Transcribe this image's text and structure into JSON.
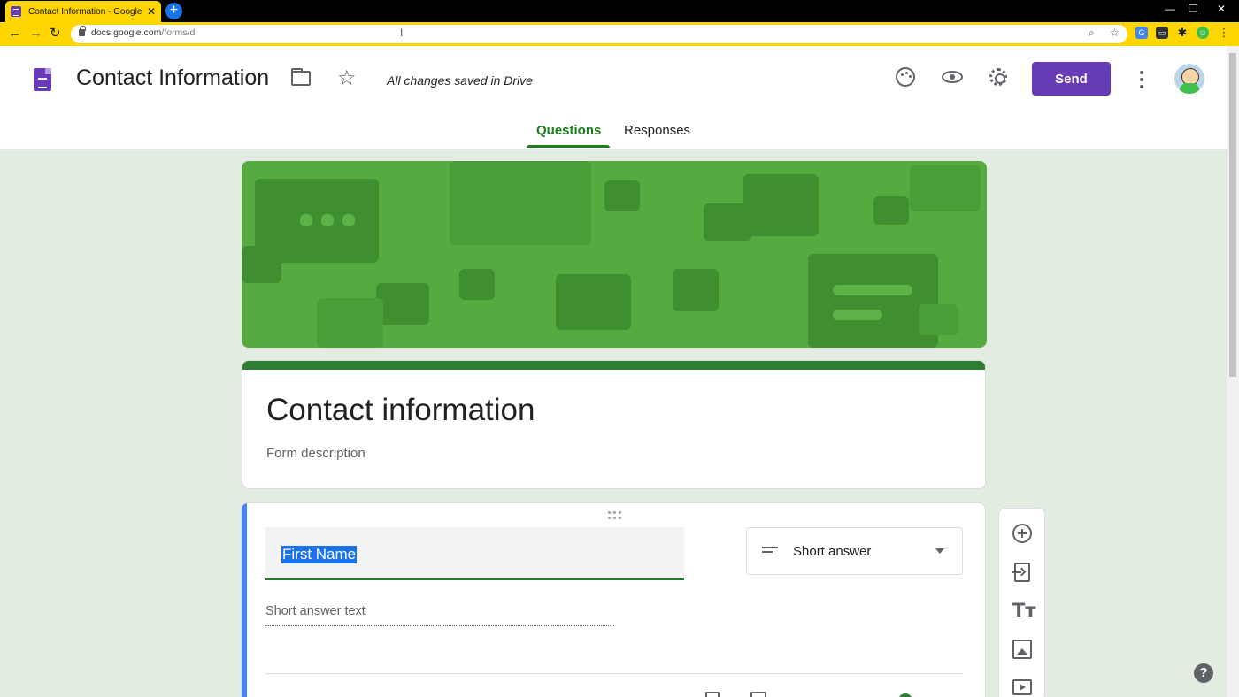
{
  "browser": {
    "tab_title": "Contact Information - Google Fo",
    "tab_close": "✕",
    "new_tab": "+",
    "window_controls": {
      "minimize": "—",
      "restore": "❐",
      "close": "✕"
    },
    "nav": {
      "back": "←",
      "forward": "→",
      "reload": "↻"
    },
    "url_host": "docs.google.com",
    "url_path": "/forms/d",
    "cursor_glyph": "I"
  },
  "app": {
    "doc_title": "Contact Information",
    "save_status": "All changes saved in Drive",
    "send_label": "Send",
    "tabs": [
      {
        "label": "Questions",
        "active": true
      },
      {
        "label": "Responses",
        "active": false
      }
    ],
    "accent_color": "#673ab7",
    "theme_color": "#1e7e1e"
  },
  "form": {
    "title": "Contact information",
    "description_placeholder": "Form description"
  },
  "question": {
    "title": "First Name",
    "type_label": "Short answer",
    "answer_placeholder": "Short answer text"
  },
  "icons": {
    "star": "☆",
    "help": "?",
    "text": "Tт"
  }
}
